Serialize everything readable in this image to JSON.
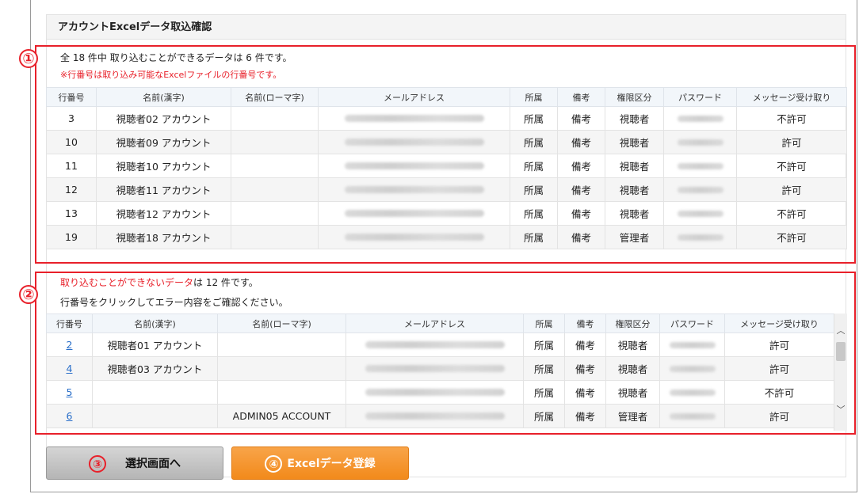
{
  "header": {
    "title": "アカウントExcelデータ取込確認"
  },
  "section1": {
    "callout_number": "①",
    "summary": "全 18 件中 取り込むことができるデータは 6 件です。",
    "note": "※行番号は取り込み可能なExcelファイルの行番号です。",
    "columns": [
      "行番号",
      "名前(漢字)",
      "名前(ローマ字)",
      "メールアドレス",
      "所属",
      "備考",
      "権限区分",
      "パスワード",
      "メッセージ受け取り"
    ],
    "rows": [
      {
        "no": "3",
        "name": "視聴者02 アカウント",
        "roman": "",
        "dept": "所属",
        "note": "備考",
        "role": "視聴者",
        "msg": "不許可"
      },
      {
        "no": "10",
        "name": "視聴者09 アカウント",
        "roman": "",
        "dept": "所属",
        "note": "備考",
        "role": "視聴者",
        "msg": "許可"
      },
      {
        "no": "11",
        "name": "視聴者10 アカウント",
        "roman": "",
        "dept": "所属",
        "note": "備考",
        "role": "視聴者",
        "msg": "不許可"
      },
      {
        "no": "12",
        "name": "視聴者11 アカウント",
        "roman": "",
        "dept": "所属",
        "note": "備考",
        "role": "視聴者",
        "msg": "許可"
      },
      {
        "no": "13",
        "name": "視聴者12 アカウント",
        "roman": "",
        "dept": "所属",
        "note": "備考",
        "role": "視聴者",
        "msg": "不許可"
      },
      {
        "no": "19",
        "name": "視聴者18 アカウント",
        "roman": "",
        "dept": "所属",
        "note": "備考",
        "role": "管理者",
        "msg": "不許可"
      }
    ]
  },
  "section2": {
    "callout_number": "②",
    "summary_red": "取り込むことができないデータ",
    "summary_rest": "は 12 件です。",
    "instruction": "行番号をクリックしてエラー内容をご確認ください。",
    "columns": [
      "行番号",
      "名前(漢字)",
      "名前(ローマ字)",
      "メールアドレス",
      "所属",
      "備考",
      "権限区分",
      "パスワード",
      "メッセージ受け取り"
    ],
    "rows": [
      {
        "no": "2",
        "name": "視聴者01 アカウント",
        "roman": "",
        "dept": "所属",
        "note": "備考",
        "role": "視聴者",
        "msg": "許可"
      },
      {
        "no": "4",
        "name": "視聴者03 アカウント",
        "roman": "",
        "dept": "所属",
        "note": "備考",
        "role": "視聴者",
        "msg": "許可"
      },
      {
        "no": "5",
        "name": "",
        "roman": "",
        "dept": "所属",
        "note": "備考",
        "role": "視聴者",
        "msg": "不許可"
      },
      {
        "no": "6",
        "name": "",
        "roman": "ADMIN05 ACCOUNT",
        "dept": "所属",
        "note": "備考",
        "role": "管理者",
        "msg": "許可"
      }
    ]
  },
  "buttons": {
    "back_number": "③",
    "back_label": "選択画面へ",
    "register_number": "④",
    "register_label": "Excelデータ登録"
  },
  "icons": {
    "scroll_up": "chevron-up-icon",
    "scroll_down": "chevron-down-icon"
  },
  "colors": {
    "callout": "#e8202a",
    "register_button": "#f28a1b",
    "link": "#2a6fc9"
  }
}
